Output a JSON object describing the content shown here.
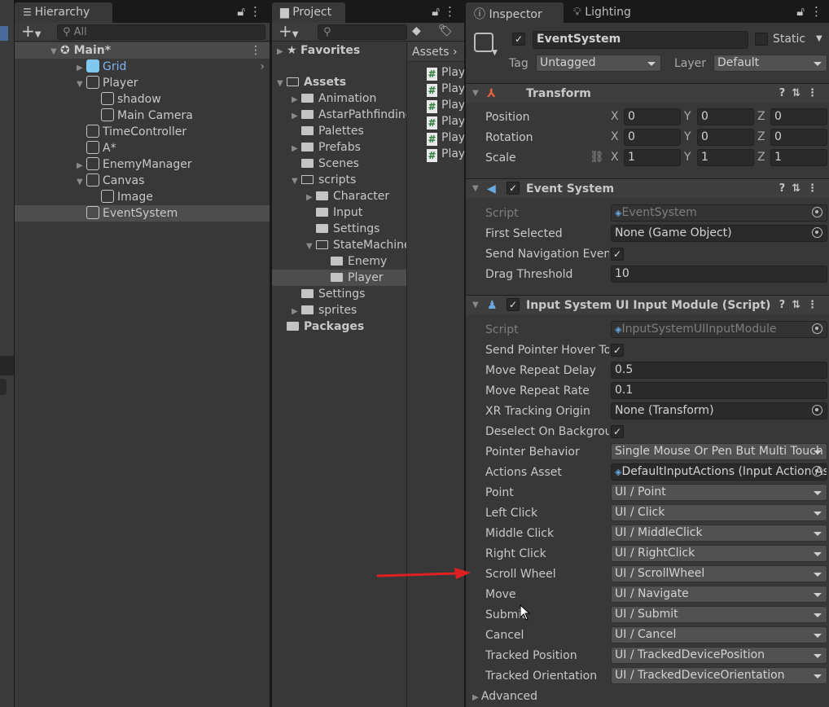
{
  "hierarchy": {
    "tab": "Hierarchy",
    "search_placeholder": "All",
    "items": [
      {
        "label": "Main*",
        "indent": 0,
        "arrow": "down",
        "icon": "unity-scene-icon",
        "bold": true,
        "state": "scene"
      },
      {
        "label": "Grid",
        "indent": 1,
        "arrow": "right",
        "icon": "prefab-cube-icon",
        "color": "#7fb4f0"
      },
      {
        "label": "Player",
        "indent": 1,
        "arrow": "down",
        "icon": "gameobject-cube-icon"
      },
      {
        "label": "shadow",
        "indent": 2,
        "icon": "gameobject-cube-icon"
      },
      {
        "label": "Main Camera",
        "indent": 2,
        "icon": "gameobject-cube-icon"
      },
      {
        "label": "TimeController",
        "indent": 1,
        "icon": "gameobject-cube-icon"
      },
      {
        "label": "A*",
        "indent": 1,
        "icon": "gameobject-cube-icon"
      },
      {
        "label": "EnemyManager",
        "indent": 1,
        "arrow": "right",
        "icon": "gameobject-cube-icon"
      },
      {
        "label": "Canvas",
        "indent": 1,
        "arrow": "down",
        "icon": "gameobject-cube-icon"
      },
      {
        "label": "Image",
        "indent": 2,
        "icon": "gameobject-cube-icon"
      },
      {
        "label": "EventSystem",
        "indent": 1,
        "icon": "gameobject-cube-icon",
        "state": "selected"
      }
    ]
  },
  "project": {
    "tab": "Project",
    "tree": [
      {
        "label": "Favorites",
        "indent": 0,
        "arrow": "right",
        "icon": "star-icon",
        "bold": true
      },
      {
        "label": "",
        "indent": 0,
        "spacer": true
      },
      {
        "label": "Assets",
        "indent": 0,
        "arrow": "down",
        "icon": "folder-open-icon",
        "bold": true
      },
      {
        "label": "Animation",
        "indent": 1,
        "arrow": "right",
        "icon": "folder-icon"
      },
      {
        "label": "AstarPathfinding",
        "indent": 1,
        "arrow": "right",
        "icon": "folder-icon"
      },
      {
        "label": "Palettes",
        "indent": 1,
        "icon": "folder-icon"
      },
      {
        "label": "Prefabs",
        "indent": 1,
        "arrow": "right",
        "icon": "folder-icon"
      },
      {
        "label": "Scenes",
        "indent": 1,
        "icon": "folder-icon"
      },
      {
        "label": "scripts",
        "indent": 1,
        "arrow": "down",
        "icon": "folder-open-icon"
      },
      {
        "label": "Character",
        "indent": 2,
        "arrow": "right",
        "icon": "folder-icon"
      },
      {
        "label": "Input",
        "indent": 2,
        "icon": "folder-icon"
      },
      {
        "label": "Settings",
        "indent": 2,
        "icon": "folder-icon"
      },
      {
        "label": "StateMachine",
        "indent": 2,
        "arrow": "down",
        "icon": "folder-open-icon"
      },
      {
        "label": "Enemy",
        "indent": 3,
        "icon": "folder-icon"
      },
      {
        "label": "Player",
        "indent": 3,
        "icon": "folder-icon",
        "state": "selected"
      },
      {
        "label": "Settings",
        "indent": 1,
        "icon": "folder-icon"
      },
      {
        "label": "sprites",
        "indent": 1,
        "arrow": "right",
        "icon": "folder-icon"
      },
      {
        "label": "Packages",
        "indent": 0,
        "icon": "folder-icon",
        "bold": true
      }
    ],
    "breadcrumb": "Assets",
    "files": [
      "Play",
      "Play",
      "Play",
      "Play",
      "Play",
      "Play"
    ]
  },
  "inspector": {
    "tabs": [
      "Inspector",
      "Lighting"
    ],
    "object_name": "EventSystem",
    "active": true,
    "static_label": "Static",
    "static": false,
    "tag_label": "Tag",
    "tag": "Untagged",
    "layer_label": "Layer",
    "layer": "Default",
    "transform": {
      "title": "Transform",
      "rows": [
        {
          "label": "Position",
          "x": "0",
          "y": "0",
          "z": "0"
        },
        {
          "label": "Rotation",
          "x": "0",
          "y": "0",
          "z": "0"
        },
        {
          "label": "Scale",
          "x": "1",
          "y": "1",
          "z": "1"
        }
      ]
    },
    "event_system": {
      "title": "Event System",
      "rows": [
        {
          "label": "Script",
          "type": "object",
          "value": "EventSystem",
          "disabled": true
        },
        {
          "label": "First Selected",
          "type": "object",
          "value": "None (Game Object)"
        },
        {
          "label": "Send Navigation Events",
          "type": "check",
          "value": true
        },
        {
          "label": "Drag Threshold",
          "type": "text",
          "value": "10"
        }
      ]
    },
    "input_module": {
      "title": "Input System UI Input Module (Script)",
      "rows": [
        {
          "label": "Script",
          "type": "object",
          "value": "InputSystemUIInputModule",
          "disabled": true
        },
        {
          "label": "Send Pointer Hover To Parent",
          "type": "check",
          "value": true
        },
        {
          "label": "Move Repeat Delay",
          "type": "text",
          "value": "0.5"
        },
        {
          "label": "Move Repeat Rate",
          "type": "text",
          "value": "0.1"
        },
        {
          "label": "XR Tracking Origin",
          "type": "object",
          "value": "None (Transform)"
        },
        {
          "label": "Deselect On Background Click",
          "type": "check",
          "value": true
        },
        {
          "label": "Pointer Behavior",
          "type": "dropdown",
          "value": "Single Mouse Or Pen But Multi Touch And Track"
        },
        {
          "label": "Actions Asset",
          "type": "object",
          "value": "DefaultInputActions (Input Action Asset)"
        },
        {
          "label": "Point",
          "type": "dropdown",
          "value": "UI / Point"
        },
        {
          "label": "Left Click",
          "type": "dropdown",
          "value": "UI / Click"
        },
        {
          "label": "Middle Click",
          "type": "dropdown",
          "value": "UI / MiddleClick"
        },
        {
          "label": "Right Click",
          "type": "dropdown",
          "value": "UI / RightClick"
        },
        {
          "label": "Scroll Wheel",
          "type": "dropdown",
          "value": "UI / ScrollWheel"
        },
        {
          "label": "Move",
          "type": "dropdown",
          "value": "UI / Navigate"
        },
        {
          "label": "Submit",
          "type": "dropdown",
          "value": "UI / Submit"
        },
        {
          "label": "Cancel",
          "type": "dropdown",
          "value": "UI / Cancel"
        },
        {
          "label": "Tracked Position",
          "type": "dropdown",
          "value": "UI / TrackedDevicePosition"
        },
        {
          "label": "Tracked Orientation",
          "type": "dropdown",
          "value": "UI / TrackedDeviceOrientation"
        }
      ],
      "advanced": "Advanced"
    }
  },
  "annotation": {
    "arrow_color": "#e02020"
  },
  "colors": {
    "panel": "#383838",
    "tabbar": "#191919",
    "selection": "#4d4d4d",
    "prefab": "#7fb4f0"
  }
}
